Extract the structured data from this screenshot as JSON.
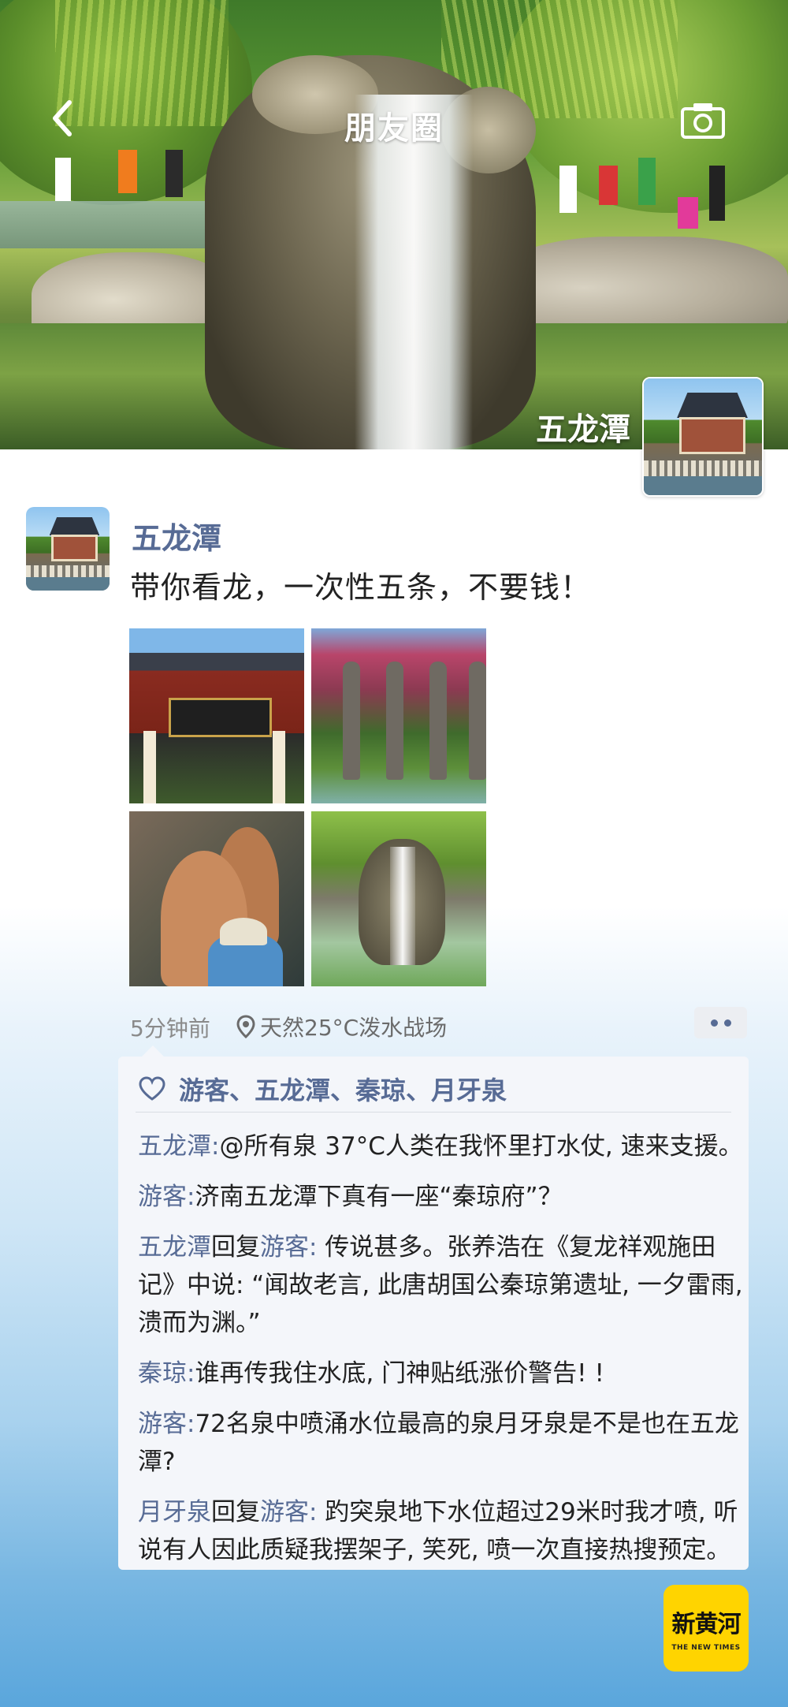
{
  "topbar": {
    "title": "朋友圈"
  },
  "cover": {
    "user_name": "五龙潭"
  },
  "post": {
    "author": "五龙潭",
    "text": "带你看龙，一次性五条，不要钱！",
    "time": "5分钟前",
    "location": "天然25°C泼水战场"
  },
  "likes": {
    "names": "游客、五龙潭、秦琼、月牙泉"
  },
  "comments": [
    {
      "author": "五龙潭",
      "reply_word": "",
      "reply_to": "",
      "sep": ":",
      "text": "@所有泉 37°C人类在我怀里打水仗, 速来支援。"
    },
    {
      "author": "游客",
      "reply_word": "",
      "reply_to": "",
      "sep": ":",
      "text": "济南五龙潭下真有一座“秦琼府”？"
    },
    {
      "author": "五龙潭",
      "reply_word": "回复",
      "reply_to": "游客",
      "sep": ":",
      "text": " 传说甚多。张养浩在《复龙祥观施田记》中说: “闻故老言, 此唐胡国公秦琼第遗址, 一夕雷雨, 溃而为渊。”"
    },
    {
      "author": "秦琼",
      "reply_word": "",
      "reply_to": "",
      "sep": ":",
      "text": "谁再传我住水底, 门神贴纸涨价警告! !"
    },
    {
      "author": "游客",
      "reply_word": "",
      "reply_to": "",
      "sep": ":",
      "text": "72名泉中喷涌水位最高的泉月牙泉是不是也在五龙潭?"
    },
    {
      "author": "月牙泉",
      "reply_word": "回复",
      "reply_to": "游客",
      "sep": ":",
      "text": " 趵突泉地下水位超过29米时我才喷, 听说有人因此质疑我摆架子, 笑死, 喷一次直接热搜预定。"
    }
  ],
  "logo": {
    "mark": "新黄河",
    "sub": "THE NEW TIMES"
  },
  "colors": {
    "name_link": "#576b95",
    "comment_bg": "#f4f6fa",
    "logo_bg": "#ffd400"
  },
  "icons": [
    "back-arrow-icon",
    "camera-icon",
    "location-pin-icon",
    "heart-icon",
    "more-dots-icon"
  ]
}
